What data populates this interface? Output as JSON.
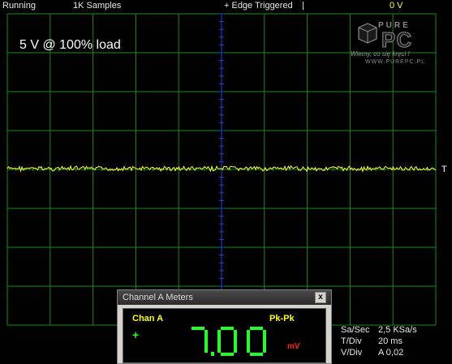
{
  "status_bar": {
    "state": "Running",
    "samples": "1K Samples",
    "trigger": "+ Edge Triggered",
    "separator": "|",
    "trigger_level": "0 V"
  },
  "screen": {
    "label": "5 V @ 100% load",
    "trigger_marker": "T",
    "trace_color": "#ffff33",
    "grid_color": "#1c8a1c",
    "center_axis_color": "#2244dd"
  },
  "logo": {
    "word_top": "PURE",
    "word_main": "PC",
    "tagline": "Wiemy, co się kręci !",
    "url": "WWW.PUREPC.PL"
  },
  "meters_panel": {
    "title": "Channel A Meters",
    "close_glyph": "x",
    "channel": "Chan A",
    "mode": "Pk-Pk",
    "sign": "+",
    "reading": "7,00",
    "unit": "mV",
    "digit_color": "#22ff22"
  },
  "timebase": {
    "sa_label": "Sa/Sec",
    "sa_value": "2,5 KSa/s",
    "tdiv_label": "T/Div",
    "tdiv_value": "20 ms",
    "vdiv_label": "V/Div",
    "vdiv_value": "A 0,02"
  }
}
